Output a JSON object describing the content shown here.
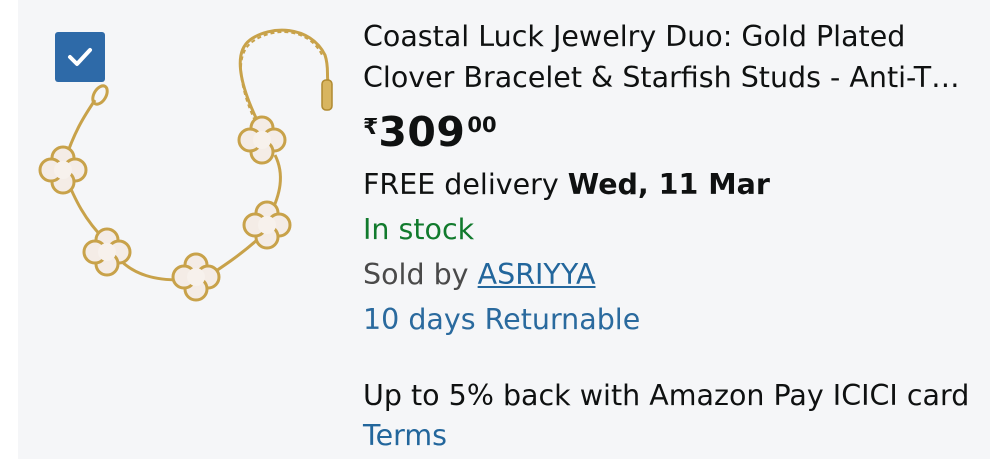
{
  "product": {
    "selected": true,
    "title_line1": "Coastal Luck Jewelry Duo: Gold Plated",
    "title_line2": "Clover Bracelet & Starfish Studs - Anti-T…",
    "price": {
      "currency_symbol": "₹",
      "whole": "309",
      "fraction": "00"
    },
    "delivery": {
      "prefix": "FREE delivery ",
      "date": "Wed, 11 Mar"
    },
    "stock_status": "In stock",
    "sold_by_prefix": "Sold by ",
    "seller": "ASRIYYA",
    "returnable": "10 days Returnable",
    "cashback_offer": "Up to 5% back with Amazon Pay ICICI card",
    "terms_link": "Terms"
  },
  "colors": {
    "accent": "#2e6aa8",
    "in_stock": "#117a2d",
    "link": "#22669c",
    "card_bg": "#f5f6f8"
  },
  "icons": {
    "checkbox": "check-icon"
  }
}
